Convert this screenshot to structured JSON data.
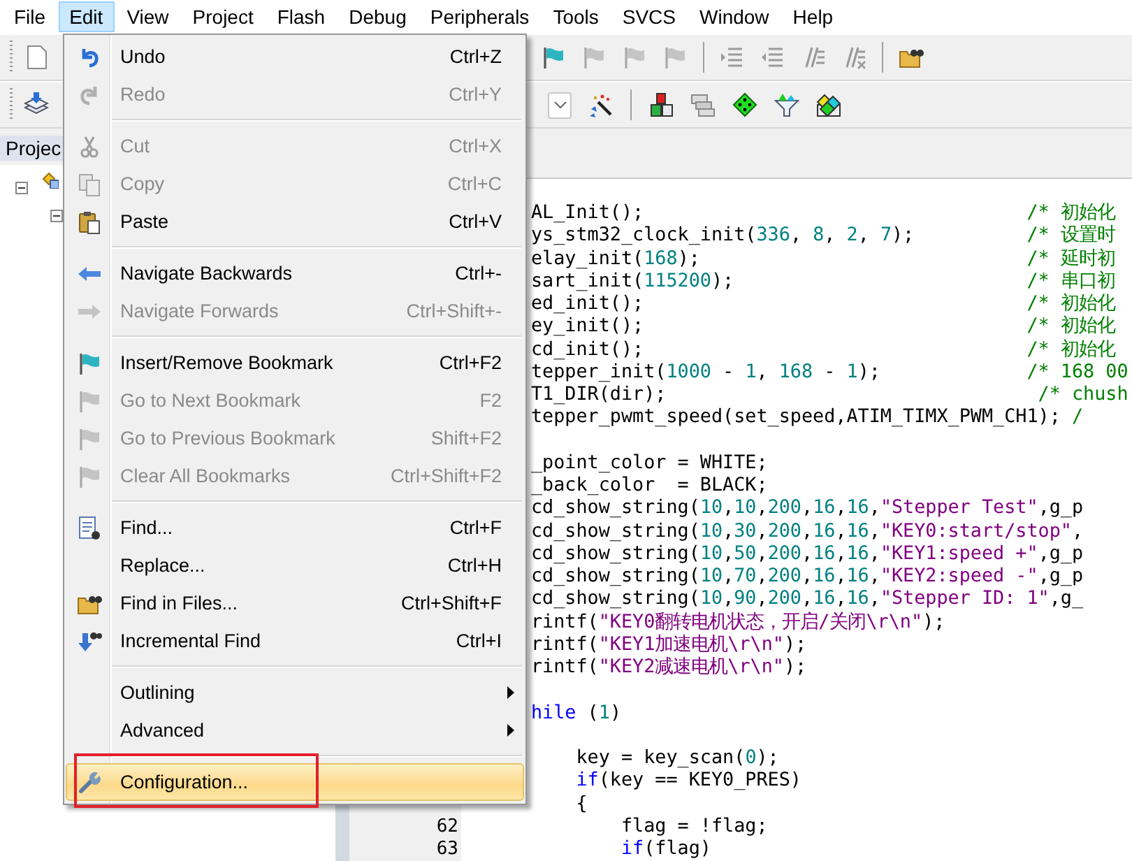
{
  "menu_bar": [
    {
      "label": "File",
      "selected": false
    },
    {
      "label": "Edit",
      "selected": true
    },
    {
      "label": "View",
      "selected": false
    },
    {
      "label": "Project",
      "selected": false
    },
    {
      "label": "Flash",
      "selected": false
    },
    {
      "label": "Debug",
      "selected": false
    },
    {
      "label": "Peripherals",
      "selected": false
    },
    {
      "label": "Tools",
      "selected": false
    },
    {
      "label": "SVCS",
      "selected": false
    },
    {
      "label": "Window",
      "selected": false
    },
    {
      "label": "Help",
      "selected": false
    }
  ],
  "project_panel": {
    "tab": "Projec"
  },
  "editor": {
    "lines": [
      {
        "segments": [
          {
            "kind": "plain",
            "text": "AL_Init();"
          }
        ],
        "comment": "/* 初始化"
      },
      {
        "segments": [
          {
            "kind": "plain",
            "text": "ys_stm32_clock_init("
          },
          {
            "kind": "num",
            "text": "336"
          },
          {
            "kind": "plain",
            "text": ", "
          },
          {
            "kind": "num",
            "text": "8"
          },
          {
            "kind": "plain",
            "text": ", "
          },
          {
            "kind": "num",
            "text": "2"
          },
          {
            "kind": "plain",
            "text": ", "
          },
          {
            "kind": "num",
            "text": "7"
          },
          {
            "kind": "plain",
            "text": ");"
          }
        ],
        "comment": "/* 设置时"
      },
      {
        "segments": [
          {
            "kind": "plain",
            "text": "elay_init("
          },
          {
            "kind": "num",
            "text": "168"
          },
          {
            "kind": "plain",
            "text": ");"
          }
        ],
        "comment": "/* 延时初"
      },
      {
        "segments": [
          {
            "kind": "plain",
            "text": "sart_init("
          },
          {
            "kind": "num",
            "text": "115200"
          },
          {
            "kind": "plain",
            "text": ");"
          }
        ],
        "comment": "/* 串口初"
      },
      {
        "segments": [
          {
            "kind": "plain",
            "text": "ed_init();"
          }
        ],
        "comment": "/* 初始化"
      },
      {
        "segments": [
          {
            "kind": "plain",
            "text": "ey_init();"
          }
        ],
        "comment": "/* 初始化"
      },
      {
        "segments": [
          {
            "kind": "plain",
            "text": "cd_init();"
          }
        ],
        "comment": "/* 初始化"
      },
      {
        "segments": [
          {
            "kind": "plain",
            "text": "tepper_init("
          },
          {
            "kind": "num",
            "text": "1000"
          },
          {
            "kind": "plain",
            "text": " - "
          },
          {
            "kind": "num",
            "text": "1"
          },
          {
            "kind": "plain",
            "text": ", "
          },
          {
            "kind": "num",
            "text": "168"
          },
          {
            "kind": "plain",
            "text": " - "
          },
          {
            "kind": "num",
            "text": "1"
          },
          {
            "kind": "plain",
            "text": ");"
          }
        ],
        "comment": "/* 168 00"
      },
      {
        "segments": [
          {
            "kind": "plain",
            "text": "T1_DIR(dir);"
          }
        ],
        "comment": " /* chush"
      },
      {
        "segments": [
          {
            "kind": "plain",
            "text": "tepper_pwmt_speed(set_speed,ATIM_TIMX_PWM_CH1); "
          },
          {
            "kind": "comment",
            "text": "/"
          }
        ]
      },
      {
        "gap_before": true,
        "segments": [
          {
            "kind": "plain",
            "text": "_point_color = WHITE;"
          }
        ]
      },
      {
        "segments": [
          {
            "kind": "plain",
            "text": "_back_color  = BLACK;"
          }
        ]
      },
      {
        "segments": [
          {
            "kind": "plain",
            "text": "cd_show_string("
          },
          {
            "kind": "num",
            "text": "10"
          },
          {
            "kind": "plain",
            "text": ","
          },
          {
            "kind": "num",
            "text": "10"
          },
          {
            "kind": "plain",
            "text": ","
          },
          {
            "kind": "num",
            "text": "200"
          },
          {
            "kind": "plain",
            "text": ","
          },
          {
            "kind": "num",
            "text": "16"
          },
          {
            "kind": "plain",
            "text": ","
          },
          {
            "kind": "num",
            "text": "16"
          },
          {
            "kind": "plain",
            "text": ","
          },
          {
            "kind": "str",
            "text": "\"Stepper Test\""
          },
          {
            "kind": "plain",
            "text": ",g_p"
          }
        ]
      },
      {
        "segments": [
          {
            "kind": "plain",
            "text": "cd_show_string("
          },
          {
            "kind": "num",
            "text": "10"
          },
          {
            "kind": "plain",
            "text": ","
          },
          {
            "kind": "num",
            "text": "30"
          },
          {
            "kind": "plain",
            "text": ","
          },
          {
            "kind": "num",
            "text": "200"
          },
          {
            "kind": "plain",
            "text": ","
          },
          {
            "kind": "num",
            "text": "16"
          },
          {
            "kind": "plain",
            "text": ","
          },
          {
            "kind": "num",
            "text": "16"
          },
          {
            "kind": "plain",
            "text": ","
          },
          {
            "kind": "str",
            "text": "\"KEY0:start/stop\""
          },
          {
            "kind": "plain",
            "text": ","
          }
        ]
      },
      {
        "segments": [
          {
            "kind": "plain",
            "text": "cd_show_string("
          },
          {
            "kind": "num",
            "text": "10"
          },
          {
            "kind": "plain",
            "text": ","
          },
          {
            "kind": "num",
            "text": "50"
          },
          {
            "kind": "plain",
            "text": ","
          },
          {
            "kind": "num",
            "text": "200"
          },
          {
            "kind": "plain",
            "text": ","
          },
          {
            "kind": "num",
            "text": "16"
          },
          {
            "kind": "plain",
            "text": ","
          },
          {
            "kind": "num",
            "text": "16"
          },
          {
            "kind": "plain",
            "text": ","
          },
          {
            "kind": "str",
            "text": "\"KEY1:speed +\""
          },
          {
            "kind": "plain",
            "text": ",g_p"
          }
        ]
      },
      {
        "segments": [
          {
            "kind": "plain",
            "text": "cd_show_string("
          },
          {
            "kind": "num",
            "text": "10"
          },
          {
            "kind": "plain",
            "text": ","
          },
          {
            "kind": "num",
            "text": "70"
          },
          {
            "kind": "plain",
            "text": ","
          },
          {
            "kind": "num",
            "text": "200"
          },
          {
            "kind": "plain",
            "text": ","
          },
          {
            "kind": "num",
            "text": "16"
          },
          {
            "kind": "plain",
            "text": ","
          },
          {
            "kind": "num",
            "text": "16"
          },
          {
            "kind": "plain",
            "text": ","
          },
          {
            "kind": "str",
            "text": "\"KEY2:speed -\""
          },
          {
            "kind": "plain",
            "text": ",g_p"
          }
        ]
      },
      {
        "segments": [
          {
            "kind": "plain",
            "text": "cd_show_string("
          },
          {
            "kind": "num",
            "text": "10"
          },
          {
            "kind": "plain",
            "text": ","
          },
          {
            "kind": "num",
            "text": "90"
          },
          {
            "kind": "plain",
            "text": ","
          },
          {
            "kind": "num",
            "text": "200"
          },
          {
            "kind": "plain",
            "text": ","
          },
          {
            "kind": "num",
            "text": "16"
          },
          {
            "kind": "plain",
            "text": ","
          },
          {
            "kind": "num",
            "text": "16"
          },
          {
            "kind": "plain",
            "text": ","
          },
          {
            "kind": "str",
            "text": "\"Stepper ID: 1\""
          },
          {
            "kind": "plain",
            "text": ",g_"
          }
        ]
      },
      {
        "segments": [
          {
            "kind": "plain",
            "text": "rintf("
          },
          {
            "kind": "str",
            "text": "\"KEY0翻转电机状态，开启/关闭\\r\\n\""
          },
          {
            "kind": "plain",
            "text": ");"
          }
        ]
      },
      {
        "segments": [
          {
            "kind": "plain",
            "text": "rintf("
          },
          {
            "kind": "str",
            "text": "\"KEY1加速电机\\r\\n\""
          },
          {
            "kind": "plain",
            "text": ");"
          }
        ]
      },
      {
        "segments": [
          {
            "kind": "plain",
            "text": "rintf("
          },
          {
            "kind": "str",
            "text": "\"KEY2减速电机\\r\\n\""
          },
          {
            "kind": "plain",
            "text": ");"
          }
        ]
      },
      {
        "gap_before": true,
        "segments": [
          {
            "kind": "kw",
            "text": "hile"
          },
          {
            "kind": "plain",
            "text": " ("
          },
          {
            "kind": "num",
            "text": "1"
          },
          {
            "kind": "plain",
            "text": ")"
          }
        ]
      },
      {
        "gap_before": true,
        "segments": [
          {
            "kind": "plain",
            "text": "    key = key_scan("
          },
          {
            "kind": "num",
            "text": "0"
          },
          {
            "kind": "plain",
            "text": ");"
          }
        ]
      },
      {
        "segments": [
          {
            "kind": "kw",
            "text": "    if"
          },
          {
            "kind": "plain",
            "text": "(key == KEY0_PRES)"
          }
        ]
      },
      {
        "segments": [
          {
            "kind": "plain",
            "text": "    {"
          }
        ]
      },
      {
        "number": "62",
        "segments": [
          {
            "kind": "plain",
            "text": "        flag = !flag;"
          }
        ]
      },
      {
        "number": "63",
        "segments": [
          {
            "kind": "kw",
            "text": "        if"
          },
          {
            "kind": "plain",
            "text": "(flag)"
          }
        ]
      }
    ]
  },
  "edit_menu": {
    "items": [
      {
        "kind": "command",
        "label": "Undo",
        "shortcut": "Ctrl+Z",
        "disabled": false,
        "selected": false
      },
      {
        "kind": "command",
        "label": "Redo",
        "shortcut": "Ctrl+Y",
        "disabled": true,
        "selected": false
      },
      {
        "kind": "separator"
      },
      {
        "kind": "command",
        "label": "Cut",
        "shortcut": "Ctrl+X",
        "disabled": true,
        "selected": false
      },
      {
        "kind": "command",
        "label": "Copy",
        "shortcut": "Ctrl+C",
        "disabled": true,
        "selected": false
      },
      {
        "kind": "command",
        "label": "Paste",
        "shortcut": "Ctrl+V",
        "disabled": false,
        "selected": false
      },
      {
        "kind": "separator"
      },
      {
        "kind": "command",
        "label": "Navigate Backwards",
        "shortcut": "Ctrl+-",
        "disabled": false,
        "selected": false
      },
      {
        "kind": "command",
        "label": "Navigate Forwards",
        "shortcut": "Ctrl+Shift+-",
        "disabled": true,
        "selected": false
      },
      {
        "kind": "separator"
      },
      {
        "kind": "command",
        "label": "Insert/Remove Bookmark",
        "shortcut": "Ctrl+F2",
        "disabled": false,
        "selected": false
      },
      {
        "kind": "command",
        "label": "Go to Next Bookmark",
        "shortcut": "F2",
        "disabled": true,
        "selected": false
      },
      {
        "kind": "command",
        "label": "Go to Previous Bookmark",
        "shortcut": "Shift+F2",
        "disabled": true,
        "selected": false
      },
      {
        "kind": "command",
        "label": "Clear All Bookmarks",
        "shortcut": "Ctrl+Shift+F2",
        "disabled": true,
        "selected": false
      },
      {
        "kind": "separator"
      },
      {
        "kind": "command",
        "label": "Find...",
        "shortcut": "Ctrl+F",
        "disabled": false,
        "selected": false
      },
      {
        "kind": "command",
        "label": "Replace...",
        "shortcut": "Ctrl+H",
        "disabled": false,
        "selected": false
      },
      {
        "kind": "command",
        "label": "Find in Files...",
        "shortcut": "Ctrl+Shift+F",
        "disabled": false,
        "selected": false
      },
      {
        "kind": "command",
        "label": "Incremental Find",
        "shortcut": "Ctrl+I",
        "disabled": false,
        "selected": false
      },
      {
        "kind": "separator"
      },
      {
        "kind": "submenu",
        "label": "Outlining",
        "disabled": false,
        "selected": false
      },
      {
        "kind": "submenu",
        "label": "Advanced",
        "disabled": false,
        "selected": false
      },
      {
        "kind": "separator"
      },
      {
        "kind": "command",
        "label": "Configuration...",
        "disabled": false,
        "selected": true
      }
    ]
  }
}
